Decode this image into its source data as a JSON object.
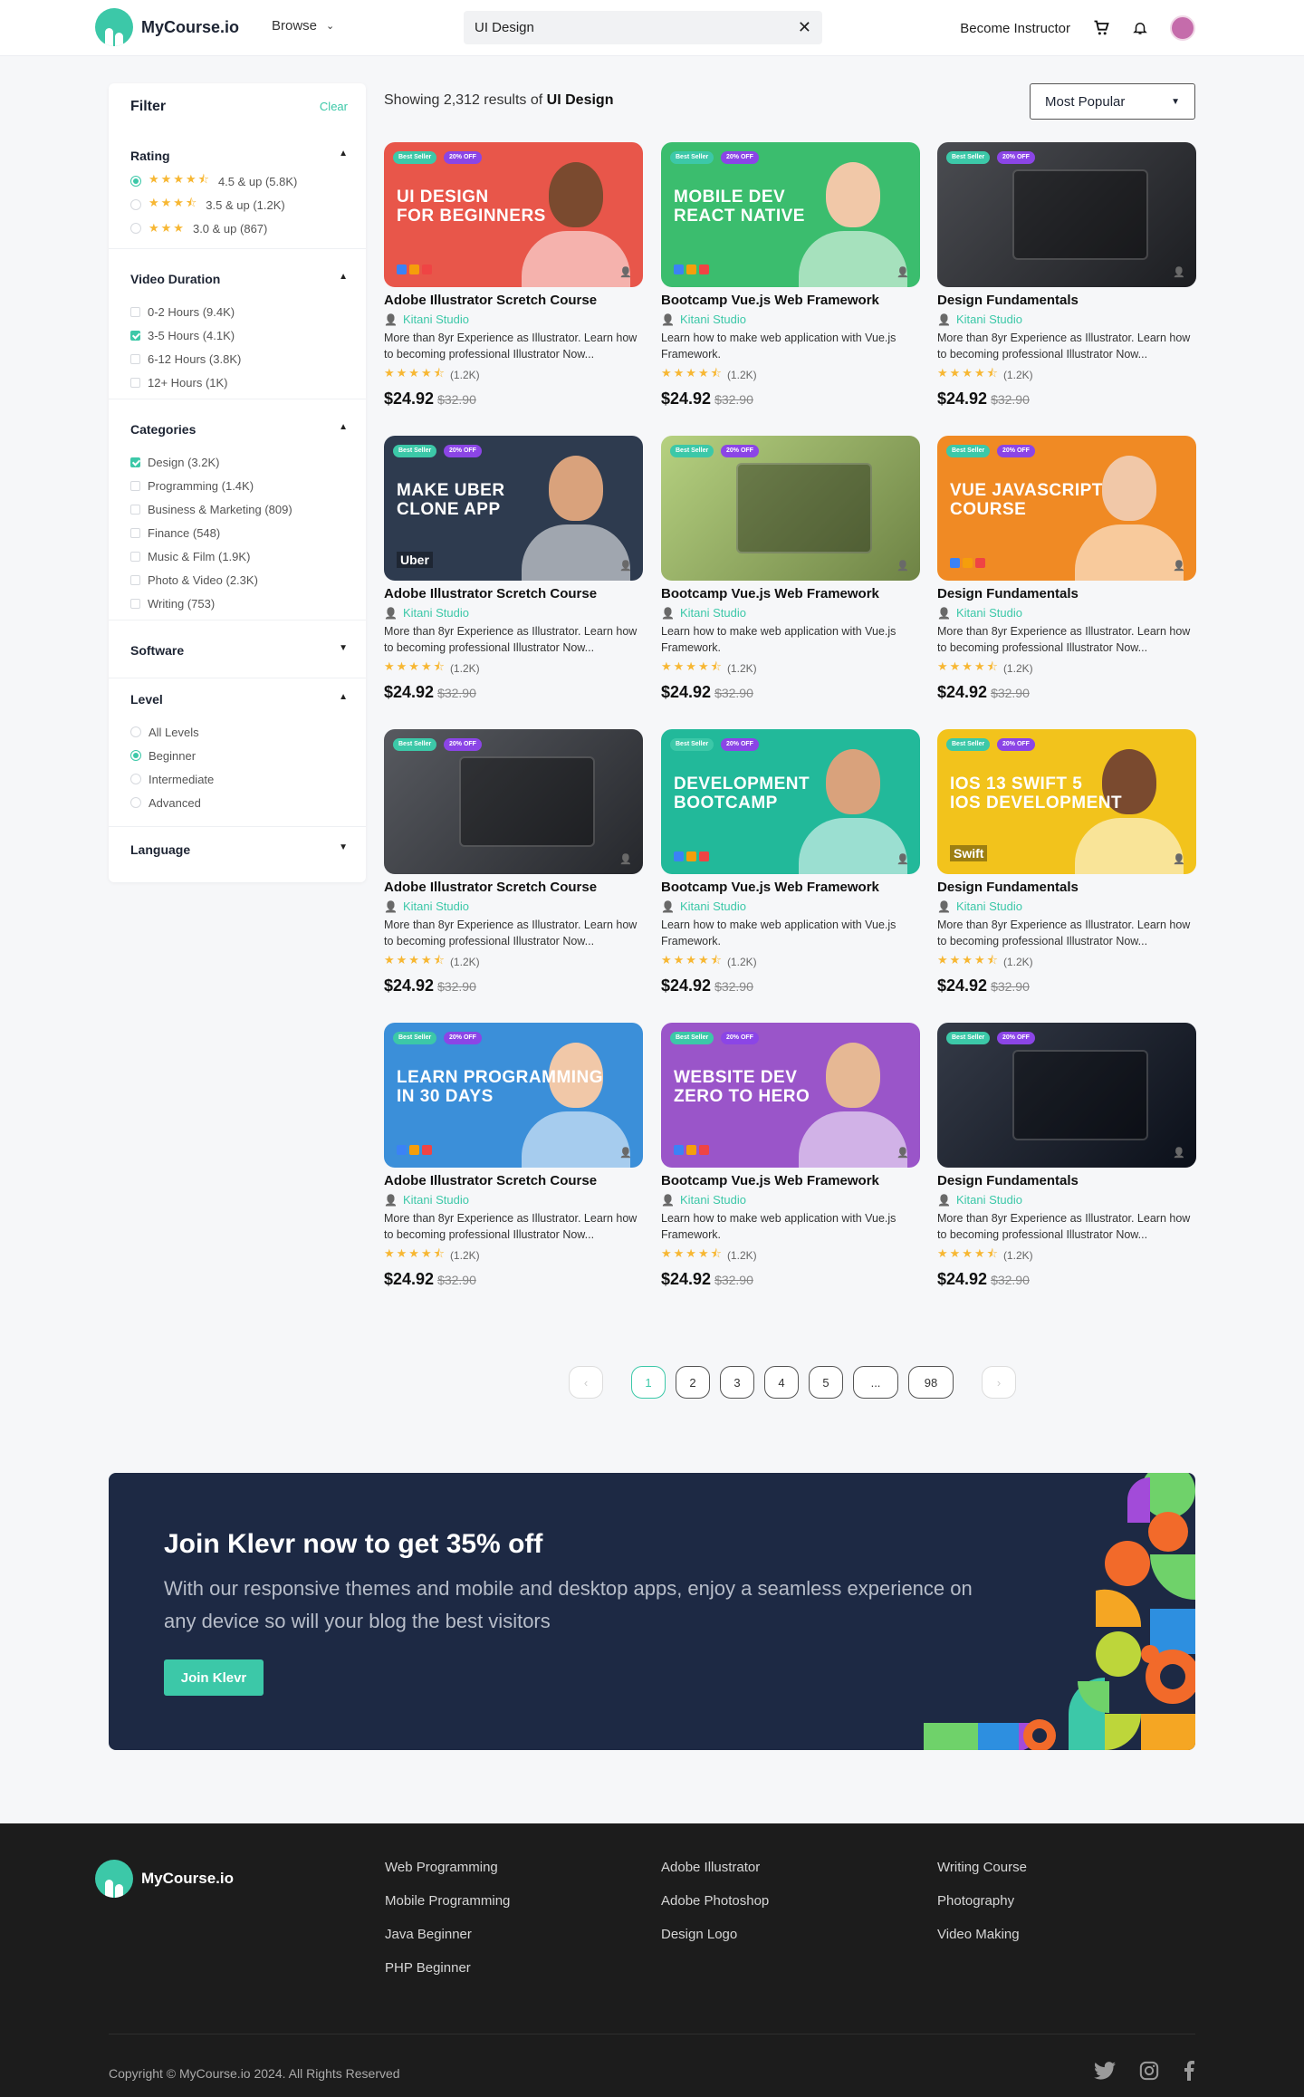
{
  "header": {
    "brand": "MyCourse.io",
    "browse_label": "Browse",
    "search_value": "UI Design",
    "become_instructor": "Become Instructor"
  },
  "sidebar": {
    "title": "Filter",
    "clear": "Clear",
    "rating": {
      "title": "Rating",
      "options": [
        {
          "label": "4.5 & up (5.8K)",
          "stars": 4.5,
          "selected": true
        },
        {
          "label": "3.5 & up (1.2K)",
          "stars": 3.5,
          "selected": false
        },
        {
          "label": "3.0 & up (867)",
          "stars": 3,
          "selected": false
        }
      ]
    },
    "duration": {
      "title": "Video Duration",
      "options": [
        {
          "label": "0-2 Hours (9.4K)",
          "checked": false
        },
        {
          "label": "3-5 Hours (4.1K)",
          "checked": true
        },
        {
          "label": "6-12 Hours (3.8K)",
          "checked": false
        },
        {
          "label": "12+ Hours (1K)",
          "checked": false
        }
      ]
    },
    "categories": {
      "title": "Categories",
      "options": [
        {
          "label": "Design (3.2K)",
          "checked": true
        },
        {
          "label": "Programming (1.4K)",
          "checked": false
        },
        {
          "label": "Business & Marketing (809)",
          "checked": false
        },
        {
          "label": "Finance (548)",
          "checked": false
        },
        {
          "label": "Music & Film (1.9K)",
          "checked": false
        },
        {
          "label": "Photo & Video (2.3K)",
          "checked": false
        },
        {
          "label": "Writing (753)",
          "checked": false
        }
      ]
    },
    "software": {
      "title": "Software"
    },
    "level": {
      "title": "Level",
      "options": [
        {
          "label": "All Levels",
          "selected": false
        },
        {
          "label": "Beginner",
          "selected": true
        },
        {
          "label": "Intermediate",
          "selected": false
        },
        {
          "label": "Advanced",
          "selected": false
        }
      ]
    },
    "language": {
      "title": "Language"
    }
  },
  "results": {
    "prefix": "Showing 2,312 results of",
    "query": "UI Design"
  },
  "sort": {
    "selected": "Most Popular"
  },
  "badges": {
    "best_seller": "Best Seller",
    "discount": "20% OFF",
    "by": "by Kitani Studio"
  },
  "courses": [
    {
      "thumb_title": "UI DESIGN\nFOR BEGINNERS",
      "name": "Adobe Illustrator Scretch Course",
      "author": "Kitani Studio",
      "desc": "More than 8yr Experience as Illustrator. Learn how to becoming professional Illustrator Now...",
      "rating": 4.5,
      "reviews": "(1.2K)",
      "price": "$24.92",
      "old_price": "$32.90",
      "bg": "#e8564a"
    },
    {
      "thumb_title": "MOBILE DEV\nREACT NATIVE",
      "name": "Bootcamp  Vue.js Web Framework",
      "author": "Kitani Studio",
      "desc": "Learn how to make web application with Vue.js Framework.",
      "rating": 4.5,
      "reviews": "(1.2K)",
      "price": "$24.92",
      "old_price": "$32.90",
      "bg": "#3bbd6e"
    },
    {
      "thumb_title": "",
      "name": "Design Fundamentals",
      "author": "Kitani Studio",
      "desc": "More than 8yr Experience as Illustrator. Learn how to becoming professional Illustrator Now...",
      "rating": 4.5,
      "reviews": "(1.2K)",
      "price": "$24.92",
      "old_price": "$32.90",
      "bg": "#2b2d33"
    },
    {
      "thumb_title": "MAKE UBER\nCLONE APP",
      "name": "Adobe Illustrator Scretch Course",
      "author": "Kitani Studio",
      "desc": "More than 8yr Experience as Illustrator. Learn how to becoming professional Illustrator Now...",
      "rating": 4.5,
      "reviews": "(1.2K)",
      "price": "$24.92",
      "old_price": "$32.90",
      "bg": "#2e3b4f",
      "extra": "Uber"
    },
    {
      "thumb_title": "",
      "name": "Bootcamp  Vue.js Web Framework",
      "author": "Kitani Studio",
      "desc": "Learn how to make web application with Vue.js Framework.",
      "rating": 4.5,
      "reviews": "(1.2K)",
      "price": "$24.92",
      "old_price": "$32.90",
      "bg": "#a9c96a"
    },
    {
      "thumb_title": "VUE JAVASCRIPT\nCOURSE",
      "name": "Design Fundamentals",
      "author": "Kitani Studio",
      "desc": "More than 8yr Experience as Illustrator. Learn how to becoming professional Illustrator Now...",
      "rating": 4.5,
      "reviews": "(1.2K)",
      "price": "$24.92",
      "old_price": "$32.90",
      "bg": "#f08a24"
    },
    {
      "thumb_title": "",
      "name": "Adobe Illustrator Scretch Course",
      "author": "Kitani Studio",
      "desc": "More than 8yr Experience as Illustrator. Learn how to becoming professional Illustrator Now...",
      "rating": 4.5,
      "reviews": "(1.2K)",
      "price": "$24.92",
      "old_price": "$32.90",
      "bg": "#3a3d44"
    },
    {
      "thumb_title": "DEVELOPMENT\nBOOTCAMP",
      "name": "Bootcamp  Vue.js Web Framework",
      "author": "Kitani Studio",
      "desc": "Learn how to make web application with Vue.js Framework.",
      "rating": 4.5,
      "reviews": "(1.2K)",
      "price": "$24.92",
      "old_price": "$32.90",
      "bg": "#22b99a"
    },
    {
      "thumb_title": "IOS 13 SWIFT 5\nIOS DEVELOPMENT",
      "name": "Design Fundamentals",
      "author": "Kitani Studio",
      "desc": "More than 8yr Experience as Illustrator. Learn how to becoming professional Illustrator Now...",
      "rating": 4.5,
      "reviews": "(1.2K)",
      "price": "$24.92",
      "old_price": "$32.90",
      "bg": "#f2c31c",
      "extra": "Swift"
    },
    {
      "thumb_title": "LEARN PROGRAMMING\nIN 30 DAYS",
      "name": "Adobe Illustrator Scretch Course",
      "author": "Kitani Studio",
      "desc": "More than 8yr Experience as Illustrator. Learn how to becoming professional Illustrator Now...",
      "rating": 4.5,
      "reviews": "(1.2K)",
      "price": "$24.92",
      "old_price": "$32.90",
      "bg": "#3b8fd9"
    },
    {
      "thumb_title": "WEBSITE DEV\nZERO TO HERO",
      "name": "Bootcamp  Vue.js Web Framework",
      "author": "Kitani Studio",
      "desc": "Learn how to make web application with Vue.js Framework.",
      "rating": 4.5,
      "reviews": "(1.2K)",
      "price": "$24.92",
      "old_price": "$32.90",
      "bg": "#9a55c9"
    },
    {
      "thumb_title": "",
      "name": "Design Fundamentals",
      "author": "Kitani Studio",
      "desc": "More than 8yr Experience as Illustrator. Learn how to becoming professional Illustrator Now...",
      "rating": 4.5,
      "reviews": "(1.2K)",
      "price": "$24.92",
      "old_price": "$32.90",
      "bg": "#111827"
    }
  ],
  "pagination": {
    "pages": [
      "1",
      "2",
      "3",
      "4",
      "5",
      "...",
      "98"
    ],
    "current": "1"
  },
  "promo": {
    "title": "Join Klevr now to get 35% off",
    "text": "With our responsive themes and mobile and desktop apps, enjoy a seamless experience on any device so will your blog the best visitors",
    "button": "Join Klevr"
  },
  "footer": {
    "brand": "MyCourse.io",
    "col1": [
      "Web Programming",
      "Mobile Programming",
      "Java Beginner",
      "PHP Beginner"
    ],
    "col2": [
      "Adobe Illustrator",
      "Adobe Photoshop",
      "Design Logo"
    ],
    "col3": [
      "Writing Course",
      "Photography",
      "Video Making"
    ],
    "copyright": "Copyright © MyCourse.io 2024. All Rights Reserved",
    "social": [
      "twitter-icon",
      "instagram-icon",
      "facebook-icon"
    ]
  },
  "colors": {
    "accent": "#3cc8a8",
    "star": "#f7b733",
    "promo_bg": "#1d2944",
    "footer_bg": "#1c1c1c"
  }
}
